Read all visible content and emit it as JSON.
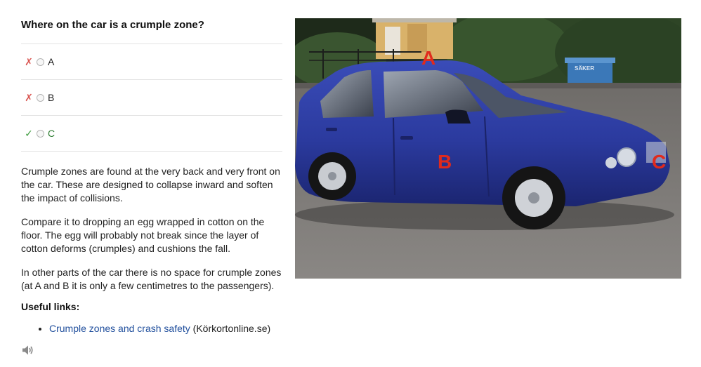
{
  "question": {
    "title": "Where on the car is a crumple zone?"
  },
  "options": [
    {
      "mark": "✗",
      "label": "A",
      "status": "wrong"
    },
    {
      "mark": "✗",
      "label": "B",
      "status": "wrong"
    },
    {
      "mark": "✓",
      "label": "C",
      "status": "correct"
    }
  ],
  "explanation": {
    "p1": "Crumple zones are found at the very back and very front on the car. These are designed to collapse inward and soften the impact of collisions.",
    "p2": "Compare it to dropping an egg wrapped in cotton on the floor. The egg will probably not break since the layer of cotton deforms (crumples) and cushions the fall.",
    "p3": "In other parts of the car there is no space for crumple zones (at A and B it is only a few centimetres to the passengers)."
  },
  "useful_links": {
    "title": "Useful links:",
    "items": [
      {
        "link_text": "Crumple zones and crash safety",
        "source": "(Körkortonline.se)"
      }
    ]
  },
  "audio": {
    "icon": "speaker-icon"
  },
  "image": {
    "markers": {
      "a": "A",
      "b": "B",
      "c": "C"
    },
    "sign_text": "SÄKER",
    "marker_color": "#e02a1d",
    "car_color": "#2a3a9c"
  }
}
